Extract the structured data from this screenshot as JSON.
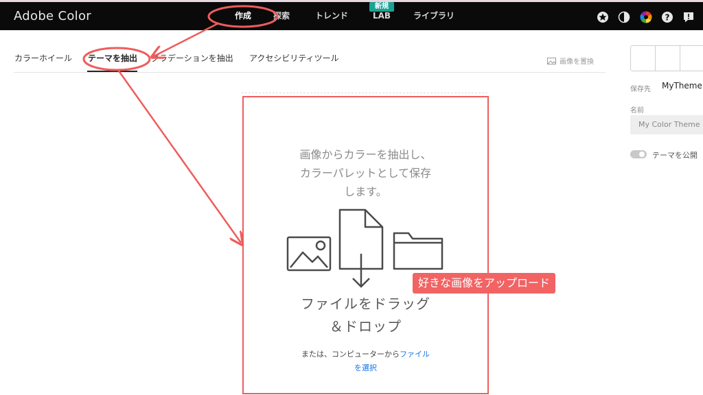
{
  "app": {
    "title": "Adobe Color"
  },
  "nav": {
    "items": [
      {
        "label": "作成",
        "active": true
      },
      {
        "label": "探索"
      },
      {
        "label": "トレンド"
      },
      {
        "label": "LAB"
      },
      {
        "label": "ライブラリ"
      }
    ],
    "new_badge": "新規"
  },
  "top_icons": [
    "star-icon",
    "contrast-icon",
    "color-wheel-icon",
    "help-icon",
    "feedback-icon"
  ],
  "tabs": {
    "items": [
      {
        "label": "カラーホイール"
      },
      {
        "label": "テーマを抽出",
        "active": true
      },
      {
        "label": "グラデーションを抽出"
      },
      {
        "label": "アクセシビリティツール"
      }
    ],
    "replace_image": "画像を置換"
  },
  "right_panel": {
    "save_to_label": "保存先",
    "save_to_value": "MyTheme",
    "name_label": "名前",
    "name_placeholder": "My Color Theme",
    "publish_label": "テーマを公開"
  },
  "dropzone": {
    "intro_line1": "画像からカラーを抽出し、",
    "intro_line2": "カラーパレットとして保存",
    "intro_line3": "します。",
    "drag_line1": "ファイルをドラッグ",
    "drag_line2": "＆ドロップ",
    "or_text": "または、コンピューターから",
    "link_part1": "ファイル",
    "link_part2": "を選択"
  },
  "annotation": {
    "callout": "好きな画像をアップロード"
  },
  "colors": {
    "accent": "#ef5c5c",
    "link": "#1473e6",
    "badge": "#1aa394",
    "topbar": "#0a0a0a"
  }
}
